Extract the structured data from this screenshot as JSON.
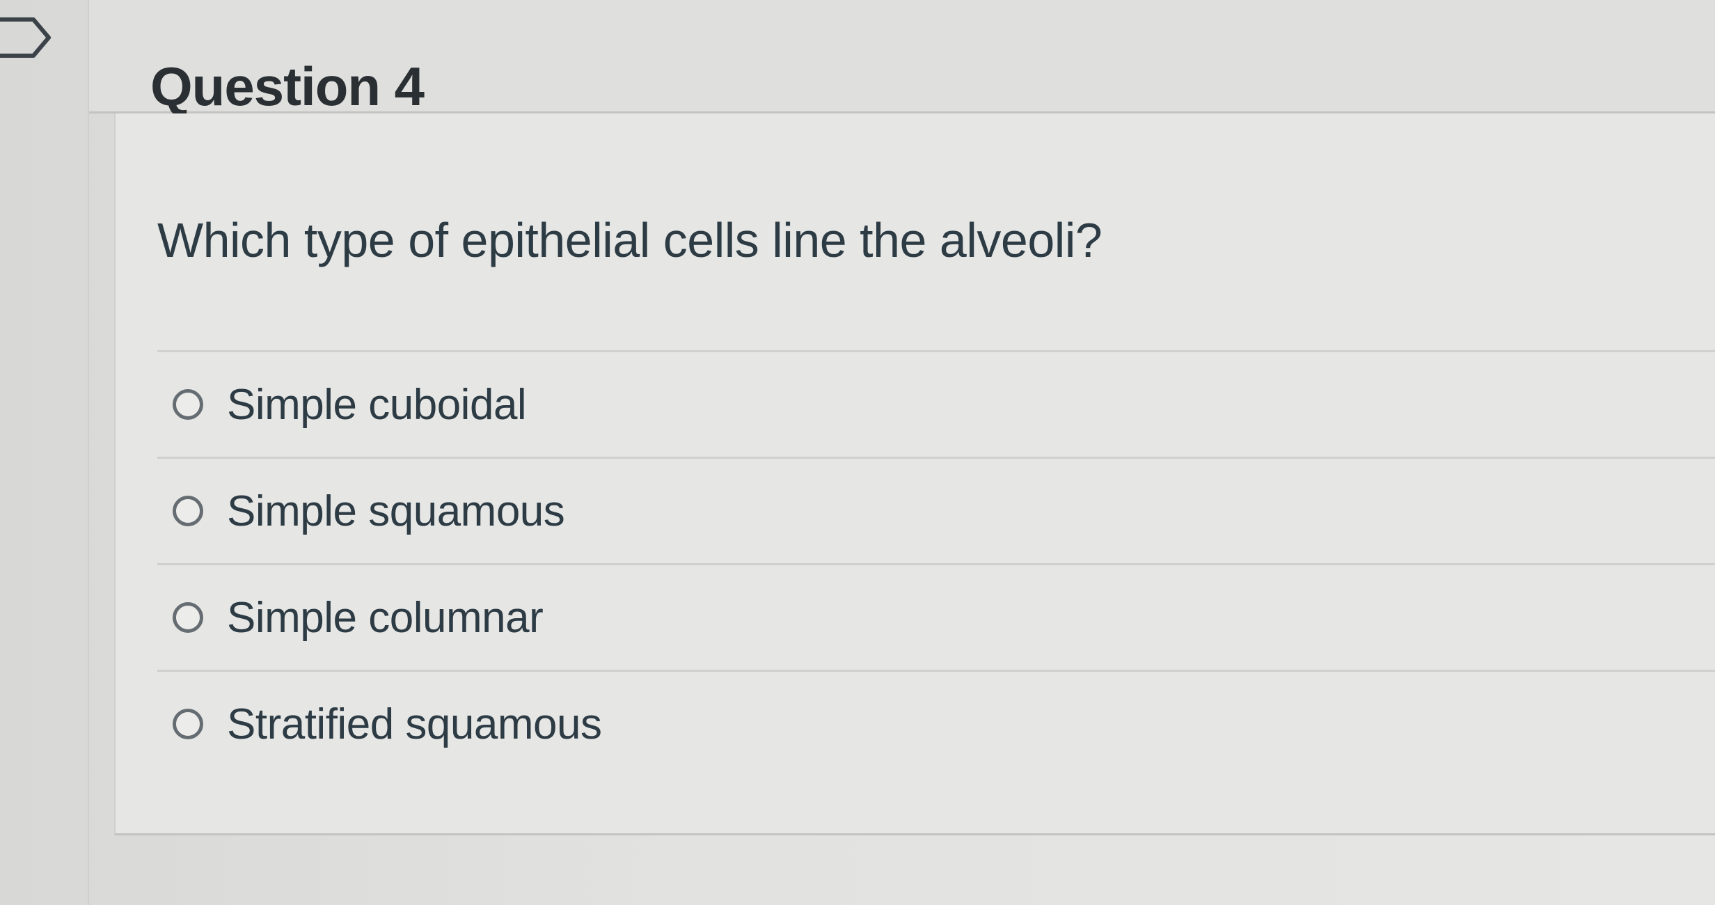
{
  "question": {
    "title": "Question 4",
    "text": "Which type of epithelial cells line the alveoli?"
  },
  "answers": [
    {
      "label": "Simple cuboidal",
      "selected": false
    },
    {
      "label": "Simple squamous",
      "selected": false
    },
    {
      "label": "Simple columnar",
      "selected": false
    },
    {
      "label": "Stratified squamous",
      "selected": false
    }
  ],
  "icons": {
    "flag": "flag-icon",
    "radio": "radio-icon"
  }
}
